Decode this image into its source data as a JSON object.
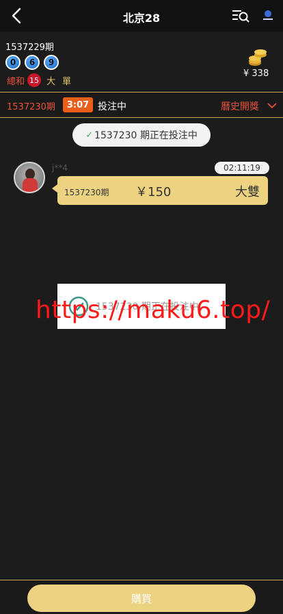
{
  "header": {
    "title": "北京28"
  },
  "last_draw": {
    "issue": "1537229期",
    "balls": [
      "0",
      "6",
      "9"
    ],
    "sum_label": "總和",
    "sum_value": "15",
    "size": "大",
    "parity": "單",
    "balance": "¥ 338"
  },
  "status_bar": {
    "issue": "1537230期",
    "countdown": "3:07",
    "state": "投注中",
    "history_label": "曆史開獎"
  },
  "notice": {
    "text": "1537230 期正在投注中"
  },
  "bet_message": {
    "username": "j**4",
    "time": "02:11:19",
    "issue": "1537230期",
    "amount": "￥150",
    "bet_type": "大雙"
  },
  "toast": {
    "text": "1537230 期正在投注中、"
  },
  "watermark": {
    "text": "https://maku6.top/"
  },
  "footer": {
    "buy_label": "購買"
  },
  "colors": {
    "accent_gold": "#ecd281",
    "accent_red": "#e9513b",
    "timer_orange": "#e95e18",
    "background": "#1c1c1c"
  }
}
